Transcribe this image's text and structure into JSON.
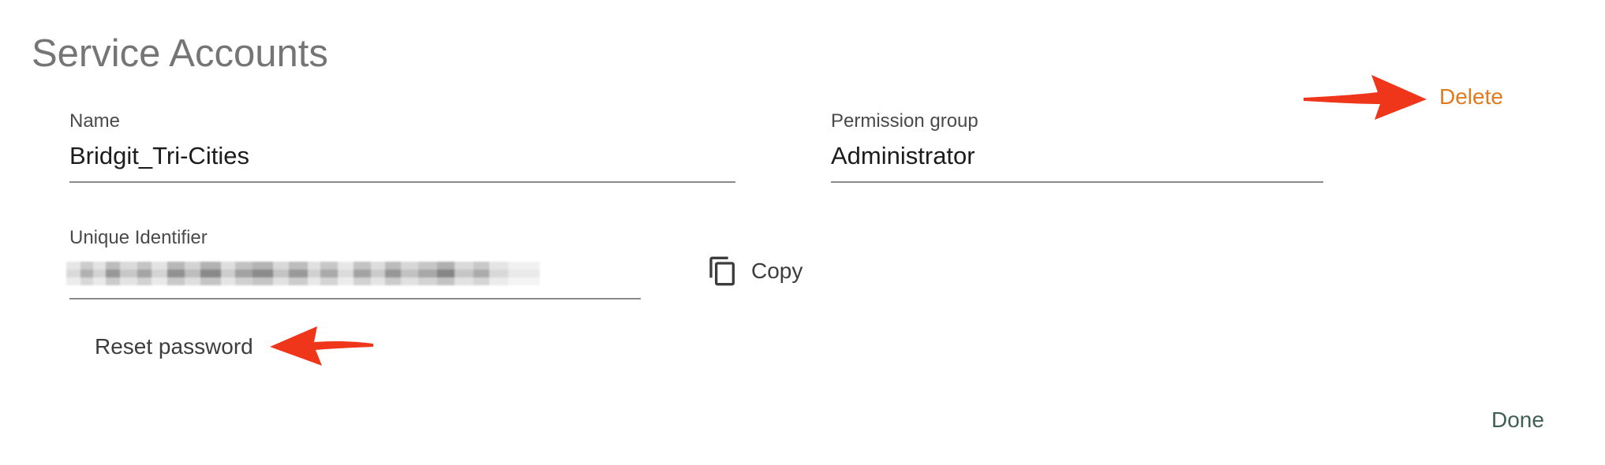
{
  "header": {
    "title": "Service Accounts"
  },
  "form": {
    "name": {
      "label": "Name",
      "value": "Bridgit_Tri-Cities"
    },
    "permission_group": {
      "label": "Permission group",
      "value": "Administrator"
    },
    "unique_identifier": {
      "label": "Unique Identifier",
      "value_state": "redacted (pixelated)"
    }
  },
  "actions": {
    "copy_label": "Copy",
    "copy_icon": "copy-icon",
    "reset_password_label": "Reset password",
    "delete_label": "Delete",
    "done_label": "Done"
  },
  "annotations": {
    "arrow_color": "#f0361a"
  },
  "colors": {
    "delete": "#e07a1f",
    "done": "#3f5f55",
    "title": "#757575"
  }
}
